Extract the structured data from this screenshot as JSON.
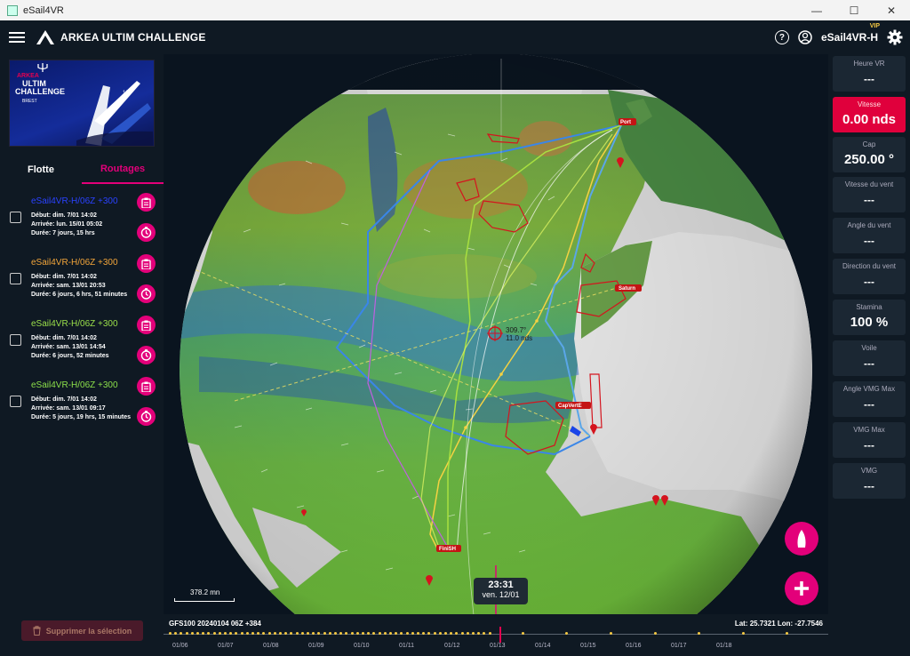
{
  "window": {
    "title": "eSail4VR",
    "minimize": "—",
    "maximize": "☐",
    "close": "✕"
  },
  "app": {
    "title": "ARKEA ULTIM CHALLENGE",
    "help": "?",
    "user": "eSail4VR-H",
    "vip": "VIP"
  },
  "banner": {
    "line1": "ARKEA",
    "line2": "ULTIM",
    "line3": "CHALLENGE",
    "line4": "BREST"
  },
  "tabs": [
    {
      "label": "Flotte"
    },
    {
      "label": "Routages"
    }
  ],
  "routes": [
    {
      "name": "eSail4VR-H/06Z +300",
      "color": "#2a42ff",
      "start": "Début: dim. 7/01 14:02",
      "arrival": "Arrivée: lun. 15/01 05:02",
      "duration": "Durée: 7 jours, 15 hrs"
    },
    {
      "name": "eSail4VR-H/06Z +300",
      "color": "#f2a53a",
      "start": "Début: dim. 7/01 14:02",
      "arrival": "Arrivée: sam. 13/01 20:53",
      "duration": "Durée: 6 jours, 6 hrs, 51 minutes"
    },
    {
      "name": "eSail4VR-H/06Z +300",
      "color": "#9be04a",
      "start": "Début: dim. 7/01 14:02",
      "arrival": "Arrivée: sam. 13/01 14:54",
      "duration": "Durée: 6 jours, 52 minutes"
    },
    {
      "name": "eSail4VR-H/06Z +300",
      "color": "#8ce04a",
      "start": "Début: dim. 7/01 14:02",
      "arrival": "Arrivée: sam. 13/01 09:17",
      "duration": "Durée: 5 jours, 19 hrs, 15 minutes"
    }
  ],
  "delete_label": "Supprimer la sélection",
  "stats": [
    {
      "label": "Heure VR",
      "value": "---"
    },
    {
      "label": "Vitesse",
      "value": "0.00 nds"
    },
    {
      "label": "Cap",
      "value": "250.00 °"
    },
    {
      "label": "Vitesse du vent",
      "value": "---"
    },
    {
      "label": "Angle du vent",
      "value": "---"
    },
    {
      "label": "Direction du vent",
      "value": "---"
    },
    {
      "label": "Stamina",
      "value": "100 %"
    },
    {
      "label": "Voile",
      "value": "---"
    },
    {
      "label": "Angle VMG Max",
      "value": "---"
    },
    {
      "label": "VMG Max",
      "value": "---"
    },
    {
      "label": "VMG",
      "value": "---"
    }
  ],
  "map": {
    "cursor_line1": "309.7°",
    "cursor_line2": "11.0 nds",
    "scale": "378.2 mn",
    "labels": {
      "ponant": "Ponton",
      "saturn": "Saturn",
      "capvert": "CapVertE",
      "arrival": "FiniSH"
    }
  },
  "time": {
    "hour": "23:31",
    "date": "ven. 12/01"
  },
  "timeline": {
    "model": "GFS100 20240104 06Z +384",
    "latlon": "Lat: 25.7321 Lon: -27.7546",
    "dates": [
      "01/06",
      "01/07",
      "01/08",
      "01/09",
      "01/10",
      "01/11",
      "01/12",
      "01/13",
      "01/14",
      "01/15",
      "01/16",
      "01/17",
      "01/18"
    ]
  }
}
